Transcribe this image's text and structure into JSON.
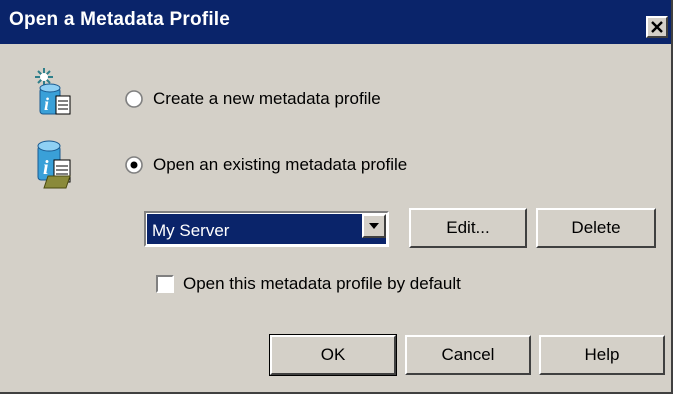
{
  "window": {
    "title": "Open a Metadata Profile",
    "close_icon": "close-icon"
  },
  "options": {
    "create_label": "Create a new metadata profile",
    "create_selected": false,
    "open_label": "Open an existing metadata profile",
    "open_selected": true
  },
  "profile_select": {
    "value": "My Server"
  },
  "buttons": {
    "edit": "Edit...",
    "delete": "Delete",
    "ok": "OK",
    "cancel": "Cancel",
    "help": "Help"
  },
  "default_checkbox": {
    "label": "Open this metadata profile by default",
    "checked": false
  },
  "colors": {
    "titlebar": "#0a246a",
    "dialog_bg": "#d4d0c8",
    "selection": "#0a246a"
  }
}
